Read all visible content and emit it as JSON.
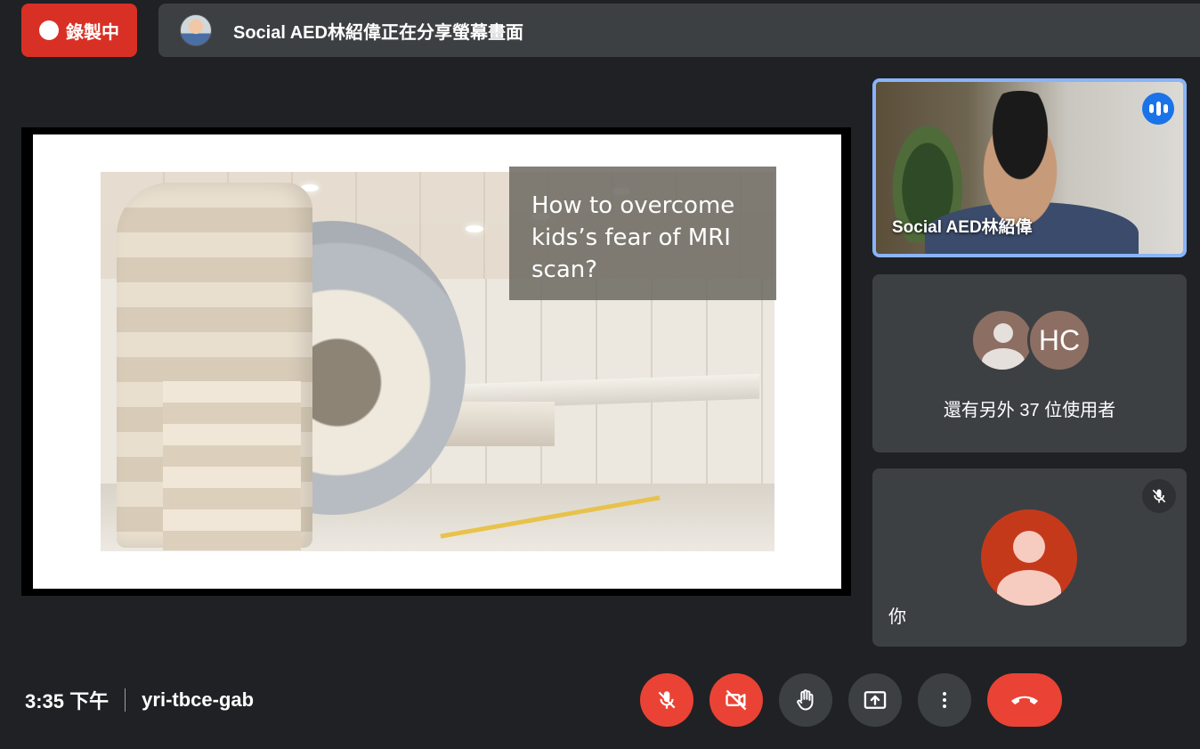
{
  "recording": {
    "label": "錄製中"
  },
  "share_banner": {
    "text": "Social AED林紹偉正在分享螢幕畫面"
  },
  "slide": {
    "caption_lines": [
      "How to overcome",
      "kids’s fear of MRI",
      "scan?"
    ]
  },
  "participants": {
    "speaker": {
      "name": "Social AED林紹偉"
    },
    "others": {
      "initials": "HC",
      "more_text": "還有另外 37 位使用者"
    },
    "self": {
      "label": "你"
    }
  },
  "footer": {
    "time": "3:35 下午",
    "meeting_code": "yri-tbce-gab"
  },
  "controls": [
    {
      "id": "mic",
      "icon": "mic-off-icon",
      "state": "off"
    },
    {
      "id": "camera",
      "icon": "camera-off-icon",
      "state": "off"
    },
    {
      "id": "raise-hand",
      "icon": "hand-icon"
    },
    {
      "id": "present",
      "icon": "present-screen-icon"
    },
    {
      "id": "more",
      "icon": "more-vert-icon"
    },
    {
      "id": "leave",
      "icon": "call-end-icon"
    }
  ],
  "colors": {
    "background": "#202124",
    "tile": "#3c4043",
    "danger": "#ea4335",
    "speaking_border": "#8ab4f8",
    "accent_blue": "#1a73e8"
  }
}
